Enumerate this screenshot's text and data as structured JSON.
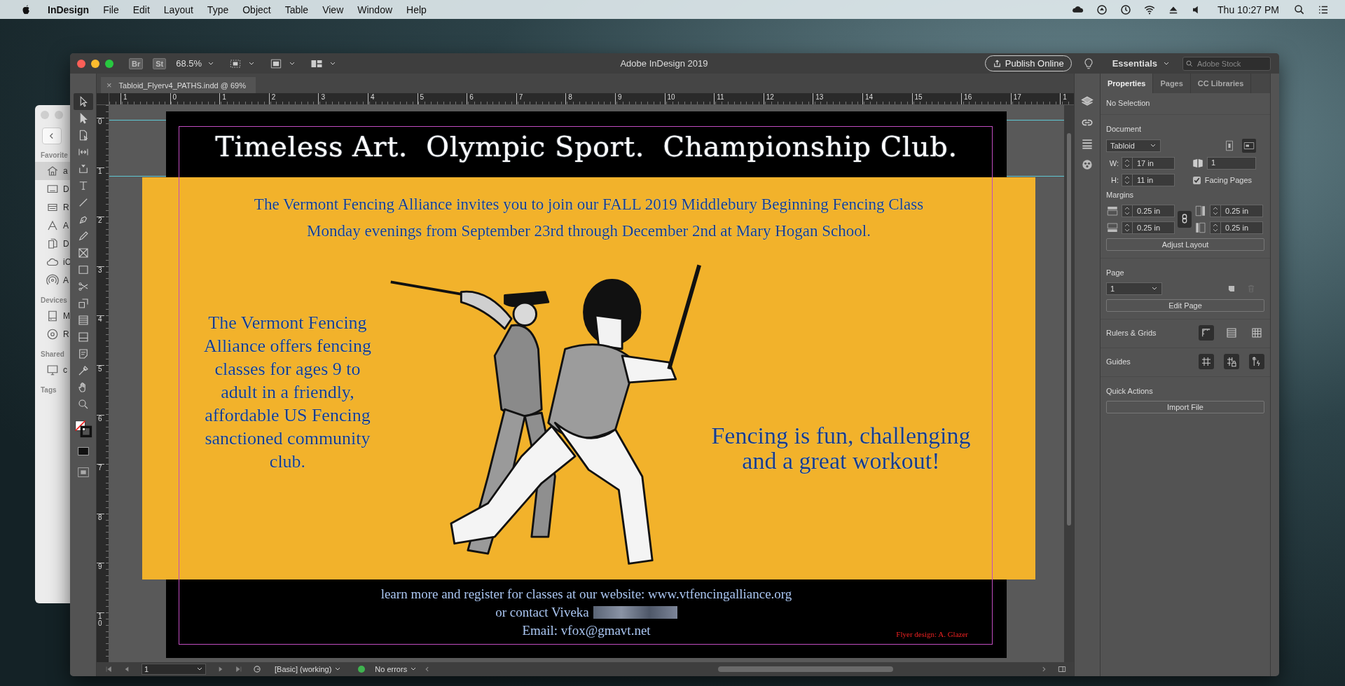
{
  "menu_bar": {
    "app_name": "InDesign",
    "menus": [
      "File",
      "Edit",
      "Layout",
      "Type",
      "Object",
      "Table",
      "View",
      "Window",
      "Help"
    ],
    "clock": "Thu 10:27 PM"
  },
  "finder_sidebar": {
    "sections": [
      {
        "label": "Favorite",
        "items": [
          {
            "label": "a",
            "kind": "home",
            "selected": true
          },
          {
            "label": "D",
            "kind": "desktop",
            "selected": false
          },
          {
            "label": "R",
            "kind": "recents",
            "selected": false
          },
          {
            "label": "A",
            "kind": "apps",
            "selected": false
          },
          {
            "label": "D",
            "kind": "documents",
            "selected": false
          },
          {
            "label": "iC",
            "kind": "cloud",
            "selected": false
          },
          {
            "label": "A",
            "kind": "airdrop",
            "selected": false
          }
        ]
      },
      {
        "label": "Devices",
        "items": [
          {
            "label": "M",
            "kind": "disk",
            "selected": false
          },
          {
            "label": "R",
            "kind": "disc",
            "selected": false
          }
        ]
      },
      {
        "label": "Shared",
        "items": [
          {
            "label": "c",
            "kind": "monitor",
            "selected": false
          }
        ]
      },
      {
        "label": "Tags"
      }
    ]
  },
  "window": {
    "title": "Adobe InDesign 2019",
    "bridge": "Br",
    "stock": "St",
    "zoom": "68.5%",
    "publish_button": "Publish Online",
    "workspace": "Essentials",
    "search": {
      "placeholder": "Adobe Stock"
    }
  },
  "document_tab": {
    "close": "×",
    "title": "Tabloid_Flyerv4_PATHS.indd @ 69%"
  },
  "rulers": {
    "horizontal": [
      "1",
      "0",
      "1",
      "2",
      "3",
      "4",
      "5",
      "6",
      "7",
      "8",
      "9",
      "10",
      "11",
      "12",
      "13",
      "14",
      "15",
      "16",
      "17",
      "1"
    ],
    "vertical": [
      "0",
      "1",
      "2",
      "3",
      "4",
      "5",
      "6",
      "7",
      "8",
      "9",
      "10"
    ]
  },
  "tools": [
    {
      "kind": "selection",
      "selected": true
    },
    {
      "kind": "direct",
      "selected": false
    },
    {
      "kind": "page",
      "selected": false
    },
    {
      "kind": "gap",
      "selected": false
    },
    {
      "kind": "collector",
      "selected": false
    },
    {
      "kind": "type",
      "selected": false
    },
    {
      "kind": "line",
      "selected": false
    },
    {
      "kind": "pen",
      "selected": false
    },
    {
      "kind": "pencil",
      "selected": false
    },
    {
      "kind": "frame",
      "selected": false
    },
    {
      "kind": "rect",
      "selected": false
    },
    {
      "kind": "scissors",
      "selected": false
    },
    {
      "kind": "transform",
      "selected": false
    },
    {
      "kind": "gradient",
      "selected": false
    },
    {
      "kind": "feather",
      "selected": false
    },
    {
      "kind": "note",
      "selected": false
    },
    {
      "kind": "eyedropper",
      "selected": false
    },
    {
      "kind": "hand",
      "selected": false
    },
    {
      "kind": "zoom",
      "selected": false
    }
  ],
  "flyer": {
    "title": "Timeless Art.  Olympic Sport.  Championship Club.",
    "subtitle_lines": [
      "The Vermont Fencing Alliance invites you to join our FALL 2019 Middlebury Beginning Fencing Class",
      "Monday evenings from September 23rd through December 2nd at Mary Hogan School."
    ],
    "left_text": "The Vermont Fencing Alliance offers fencing classes for ages 9 to adult in a friendly, affordable US Fencing sanctioned community club.",
    "right_text": "Fencing is fun, challenging and a great workout!",
    "footer_lines": [
      {
        "text": "learn more and register for classes at our website: www.vtfencingalliance.org",
        "redacted": false
      },
      {
        "text": "or contact Viveka",
        "redacted": true
      },
      {
        "text": "Email: vfox@gmavt.net",
        "redacted": false
      }
    ],
    "credit": "Flyer design: A. Glazer"
  },
  "properties_panel": {
    "tabs": [
      {
        "label": "Properties",
        "selected": true
      },
      {
        "label": "Pages",
        "selected": false
      },
      {
        "label": "CC Libraries",
        "selected": false
      }
    ],
    "selection": "No Selection",
    "document": {
      "heading": "Document",
      "preset": "Tabloid",
      "orientation": [
        {
          "kind": "portrait",
          "selected": false
        },
        {
          "kind": "landscape",
          "selected": true
        }
      ],
      "width_label": "W:",
      "width": "17 in",
      "height_label": "H:",
      "height": "11 in",
      "pages": "1",
      "facing_pages": {
        "label": "Facing Pages",
        "checked": true
      }
    },
    "margins": {
      "heading": "Margins",
      "top": "0.25 in",
      "bottom": "0.25 in",
      "inside": "0.25 in",
      "outside": "0.25 in",
      "linked": true,
      "button": "Adjust Layout"
    },
    "page": {
      "heading": "Page",
      "value": "1",
      "button": "Edit Page"
    },
    "rulers_grids": {
      "heading": "Rulers & Grids",
      "buttons": [
        {
          "kind": "ruler",
          "selected": true
        },
        {
          "kind": "baseline",
          "selected": false
        },
        {
          "kind": "grid",
          "selected": false
        }
      ]
    },
    "guides": {
      "heading": "Guides",
      "buttons": [
        {
          "kind": "guides"
        },
        {
          "kind": "lock"
        },
        {
          "kind": "smart"
        }
      ]
    },
    "quick_actions": {
      "heading": "Quick Actions",
      "button": "Import File"
    }
  },
  "status_bar": {
    "page": "1",
    "preflight_profile": "[Basic] (working)",
    "preflight_status": "No errors",
    "errors": false
  }
}
